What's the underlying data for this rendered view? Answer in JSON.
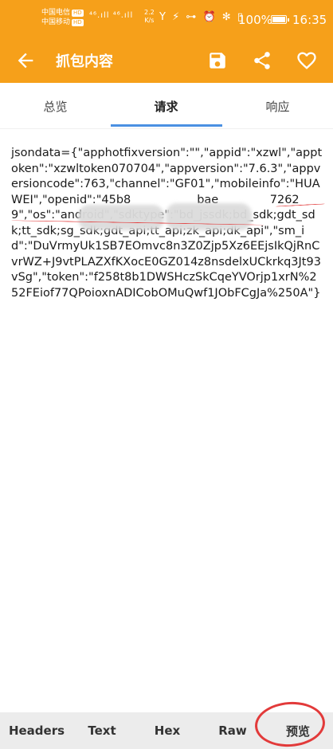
{
  "status_bar": {
    "carrier1": "中国电信",
    "carrier2": "中国移动",
    "hd": "HD",
    "signal": "⁴⁶.ıll ⁴⁶.ıll",
    "net_speed_value": "2.2",
    "net_speed_unit": "K/s",
    "icons_text": "Y ⚡ ⊶ ⏰ ✻ ▯",
    "battery": "100%",
    "time": "16:35"
  },
  "app_bar": {
    "title": "抓包内容",
    "back_icon": "arrow-left",
    "save_icon": "save",
    "share_icon": "share",
    "favorite_icon": "heart-outline"
  },
  "tabs": [
    {
      "label": "总览"
    },
    {
      "label": "请求"
    },
    {
      "label": "响应"
    }
  ],
  "active_tab": "请求",
  "request_body": "jsondata={\"apphotfixversion\":\"\",\"appid\":\"xzwl\",\"apptoken\":\"xzwltoken070704\",\"appversion\":\"7.6.3\",\"appversioncode\":763,\"channel\":\"GF01\",\"mobileinfo\":\"HUAWEI\",\"openid\":\"45b8                  bae              72629\",\"os\":\"android\",\"sdktype\":\"bd_jssdk;bd_sdk;gdt_sdk;tt_sdk;sg_sdk;gdt_api;tt_api;zk_api;dk_api\",\"sm_id\":\"DuVrmyUk1SB7EOmvc8n3Z0Zjp5Xz6EEjsIkQjRnCvrWZ+J9vtPLAZXfKXocE0GZ014z8nsdelxUCkrkq3Jt93vSg\",\"token\":\"f258t8b1DWSHczSkCqeYVOrjp1xrN%252FEiof77QPoioxnADICobOMuQwf1JObFCgJa%250A\"}",
  "bottom_tabs": [
    {
      "label": "Headers"
    },
    {
      "label": "Text"
    },
    {
      "label": "Hex"
    },
    {
      "label": "Raw"
    },
    {
      "label": "预览"
    }
  ],
  "colors": {
    "primary": "#F6A01A",
    "tab_indicator": "#4A90E2",
    "annotation": "#e23a3a"
  }
}
